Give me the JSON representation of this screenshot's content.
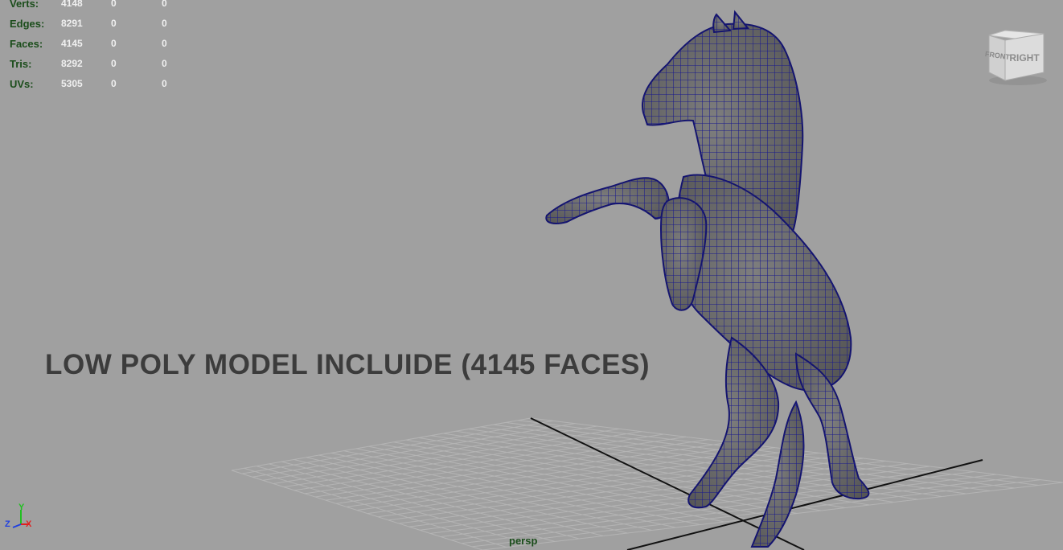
{
  "hud": {
    "rows": [
      {
        "label": "Verts:",
        "values": [
          "4148",
          "0",
          "0"
        ]
      },
      {
        "label": "Edges:",
        "values": [
          "8291",
          "0",
          "0"
        ]
      },
      {
        "label": "Faces:",
        "values": [
          "4145",
          "0",
          "0"
        ]
      },
      {
        "label": "Tris:",
        "values": [
          "8292",
          "0",
          "0"
        ]
      },
      {
        "label": "UVs:",
        "values": [
          "5305",
          "0",
          "0"
        ]
      }
    ]
  },
  "caption": "LOW POLY MODEL INCLUIDE (4145 FACES)",
  "camera_label": "persp",
  "viewcube": {
    "front": "FRONT",
    "right": "RIGHT"
  },
  "axis_indicator": {
    "y": "Y",
    "z": "Z",
    "x": "X"
  },
  "colors": {
    "viewport_bg": "#a0a0a0",
    "wire": "#1a1a8c",
    "hud_label": "#1b4d1b",
    "hud_value": "#f0f0f0",
    "caption": "#3c3c3c",
    "axis_x": "#e02020",
    "axis_y": "#20c020",
    "axis_z": "#2040e0"
  }
}
